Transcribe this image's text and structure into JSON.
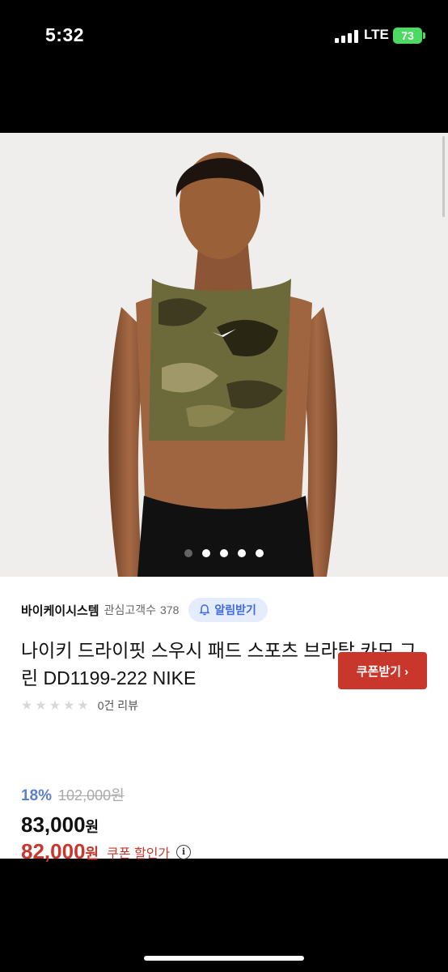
{
  "status_bar": {
    "time": "5:32",
    "network": "LTE",
    "battery": "73"
  },
  "product": {
    "seller": {
      "name": "바이케이시스템",
      "followers_label": "관심고객수",
      "followers_count": "378",
      "alert_button": "알림받기"
    },
    "title": "나이키 드라이핏 스우시 패드 스포츠 브라탑 카모 그린 DD1199-222 NIKE",
    "rating": {
      "stars": "★★★★★",
      "review_text": "0건 리뷰"
    },
    "discount_rate": "18%",
    "original_price": "102,000원",
    "price": {
      "amount": "83,000",
      "unit": "원"
    },
    "coupon_price": {
      "amount": "82,000",
      "unit": "원"
    },
    "coupon_label": "쿠폰 할인가",
    "info_icon": "i",
    "coupon_button": "쿠폰받기 ›"
  },
  "gallery": {
    "total_images": 5,
    "active_index": 0
  },
  "colors": {
    "accent_blue": "#5b7fc9",
    "accent_red": "#c9362b"
  }
}
